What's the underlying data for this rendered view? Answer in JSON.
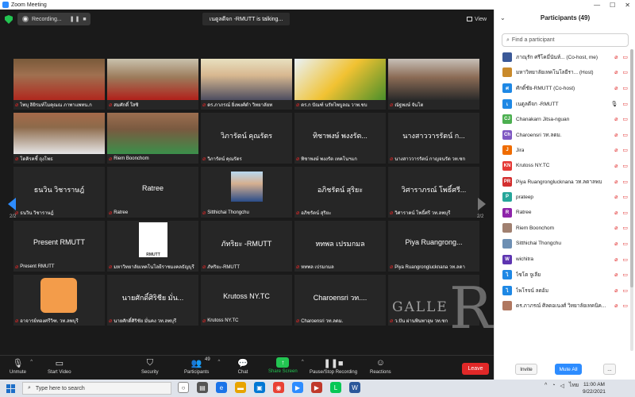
{
  "window": {
    "title": "Zoom Meeting"
  },
  "topbar": {
    "recording_label": "Recording...",
    "talking_label": "เนตูลดีจก -RMUTT is talking...",
    "view_label": "View"
  },
  "gallery": {
    "page_left": "2/2",
    "page_right": "2/2",
    "tiles": [
      {
        "name": "ไพบุ ลิยิรมท์โมคุณณ ภาพาแพทน.ก",
        "big": "",
        "video": "person-red"
      },
      {
        "name": "สมศักดิ์ ใสซิ",
        "big": "",
        "video": "person-red2"
      },
      {
        "name": "ดร.ภาภรณ์ ยิ่งพงศ์ดำ วิทยาลัยท",
        "big": "",
        "video": "person-logo"
      },
      {
        "name": "ดร.ก ปัณฑ์ นรัทไพบูลณ วาพ.ชบ",
        "big": "",
        "video": "infographic"
      },
      {
        "name": "ณัฐพงษ์ จันโต",
        "big": "",
        "video": "person-dark"
      },
      {
        "name": "โดคิรคชี้ ถุงโพธ",
        "big": "",
        "video": "person-white"
      },
      {
        "name": "Riem Boonchom",
        "big": "",
        "video": "person-green"
      },
      {
        "name": "วิภารัตน์ คุณรัตร",
        "big": "วิภารัตน์ คุณรัตร",
        "video": ""
      },
      {
        "name": "ทิชาพงษ์ พงงรัต เทคโนฯแก",
        "big": "ทิชาพงษ์ พงงรัต...",
        "video": ""
      },
      {
        "name": "นางสาววารรัตน์ กาญจนรัต วท.ซก",
        "big": "นางสาววารรัตน์ ก...",
        "video": ""
      },
      {
        "name": "ธนวิน วิชาราษฎ์",
        "big": "ธนวิน วิชาราษฎ์",
        "video": ""
      },
      {
        "name": "Ratree",
        "big": "Ratree",
        "video": ""
      },
      {
        "name": "Sitthichai Thongchu",
        "big": "",
        "video": "person-small"
      },
      {
        "name": "อภิชรัตน์ สุริยะ",
        "big": "อภิชรัตน์ สุริยะ",
        "video": ""
      },
      {
        "name": "วิศาราคน์ โพธิ์ศรี วท.ลพบุรี",
        "big": "วิศาราภรณ์ โพธิ์ศรี...",
        "video": ""
      },
      {
        "name": "Present RMUTT",
        "big": "Present RMUTT",
        "video": ""
      },
      {
        "name": "มหาวิทยาลัยเทคโนโลยีราชมงคลธัญบุรี",
        "big": "",
        "video": "rmutt-logo"
      },
      {
        "name": "ภัทริยะ-RMUTT",
        "big": "ภัทริยะ -RMUTT",
        "video": ""
      },
      {
        "name": "หทพล เปรมกมล",
        "big": "หทพล เปรมกมล",
        "video": ""
      },
      {
        "name": "Piya Ruangronglucknana วท.ลดา",
        "big": "Piya Ruangrong...",
        "video": ""
      },
      {
        "name": "อาจารย์ทองศรีวิฑ. วท.ลพบุรี",
        "big": "",
        "video": "group-icon"
      },
      {
        "name": "นายศักดิ์ศิริชัย มั่นคง วท.ลพบุรี",
        "big": "นายศักดิ์ศิริชีย มั่น...",
        "video": ""
      },
      {
        "name": "Krutoss NY.TC",
        "big": "Krutoss NY.TC",
        "video": ""
      },
      {
        "name": "Charoensri วท.ลดม.",
        "big": "Charoensri วท....",
        "video": ""
      },
      {
        "name": "ว.ปัน ผ่านพินพาอุษ วท.ซก",
        "big": "",
        "video": "watermark"
      }
    ]
  },
  "toolbar": {
    "unmute": "Unmute",
    "start_video": "Start Video",
    "security": "Security",
    "participants": "Participants",
    "participants_count": "49",
    "chat": "Chat",
    "share_screen": "Share Screen",
    "pause_recording": "Pause/Stop Recording",
    "reactions": "Reactions",
    "leave": "Leave"
  },
  "watermark": {
    "text": "GALLE",
    "letter": "R"
  },
  "panel": {
    "title": "Participants (49)",
    "search_placeholder": "Find a participant",
    "invite": "Invite",
    "mute_all": "Mute All",
    "more": "...",
    "participants": [
      {
        "name": "ภาณุรัก ศรีโคมี่นันท์... (Co-host, me)",
        "initial": "",
        "color": "#3b5998"
      },
      {
        "name": "มหาวิทยาลัยเทคโนโลยีรา... (Host)",
        "initial": "",
        "color": "#c98a2b"
      },
      {
        "name": "ศักดิ์ชัย-RMUTT (Co-host)",
        "initial": "ศ",
        "color": "#1e88e5"
      },
      {
        "name": "เนตูลดีจก -RMUTT",
        "initial": "เ",
        "color": "#1e88e5"
      },
      {
        "name": "Chanakarn Jitsa-nguan",
        "initial": "CJ",
        "color": "#4caf50"
      },
      {
        "name": "Charoensri วท.ลดม.",
        "initial": "Ch",
        "color": "#7e57c2"
      },
      {
        "name": "Jira",
        "initial": "J",
        "color": "#ef6c00"
      },
      {
        "name": "Krutoss NY.TC",
        "initial": "KN",
        "color": "#e53935"
      },
      {
        "name": "Piya Ruangronglucknana วท.ลดาลพบ",
        "initial": "PR",
        "color": "#d32f2f"
      },
      {
        "name": "prateep",
        "initial": "P",
        "color": "#26a69a"
      },
      {
        "name": "Ratree",
        "initial": "R",
        "color": "#8e24aa"
      },
      {
        "name": "Riem Boonchom",
        "initial": "",
        "color": "#a08070"
      },
      {
        "name": "Sitthichai Thongchu",
        "initial": "",
        "color": "#6d8fb3"
      },
      {
        "name": "wichitra",
        "initial": "W",
        "color": "#5e35b1"
      },
      {
        "name": "ไซโต จูเลีย",
        "initial": "ไ",
        "color": "#1e88e5"
      },
      {
        "name": "ไพโรจน์ ลดอ้ม",
        "initial": "ไ",
        "color": "#1e88e5"
      },
      {
        "name": "ดร.ภาภรณ์ ศิลดอเนงศ์ วิทยาลัยเทคนิค...",
        "initial": "",
        "color": "#b07860"
      }
    ]
  },
  "taskbar": {
    "search_placeholder": "Type here to search",
    "time": "11:00 AM",
    "date": "9/22/2021",
    "lang": "ไทย"
  }
}
